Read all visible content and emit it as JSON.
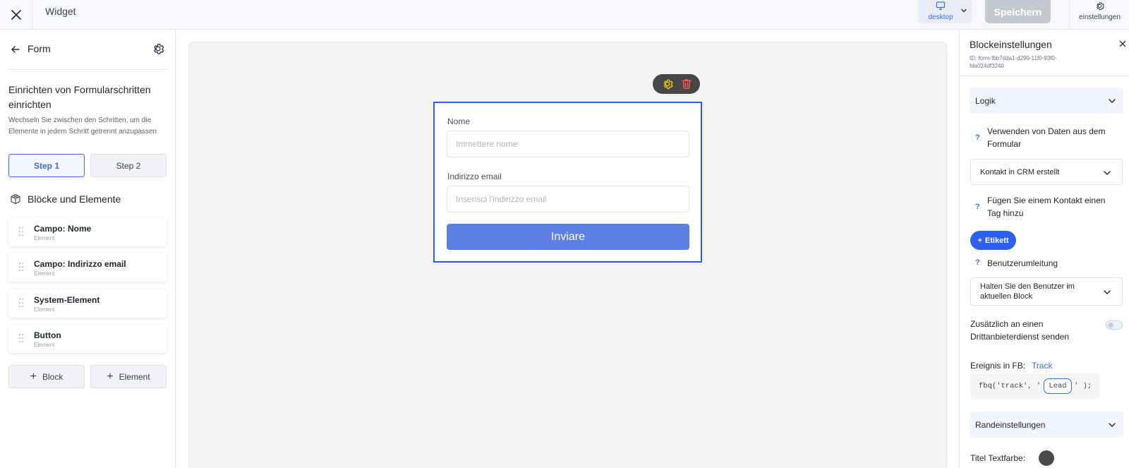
{
  "topbar": {
    "title": "Widget",
    "device_label": "desktop",
    "save_label": "Speichern",
    "settings_label": "einstellungen"
  },
  "left": {
    "header_title": "Form",
    "steps_title": "Einrichten von Formularschritten einrichten",
    "steps_description": "Wechseln Sie zwischen den Schritten, um die Elemente in jedem Schritt getrennt anzupassen",
    "steps": [
      "Step 1",
      "Step 2"
    ],
    "active_step": "Step 1",
    "blocks_title": "Blöcke und Elemente",
    "elements": [
      {
        "name": "Campo: Nome",
        "type": "Element"
      },
      {
        "name": "Campo: Indirizzo email",
        "type": "Element"
      },
      {
        "name": "System-Element",
        "type": "Element"
      },
      {
        "name": "Button",
        "type": "Element"
      }
    ],
    "add_block_label": "Block",
    "add_element_label": "Element"
  },
  "canvas": {
    "form": {
      "name_label": "Nome",
      "name_placeholder": "Immettere nome",
      "email_label": "Indirizzo email",
      "email_placeholder": "Inserisci l'indirizzo email",
      "submit_label": "Inviare"
    }
  },
  "right": {
    "title": "Blockeinstellungen",
    "block_id": "ID: form-fbb7dda1-d290-11f0-93f0-fda024df3240",
    "logic_label": "Logik",
    "use_data_label": "Verwenden von Daten aus dem Formular",
    "use_data_value": "Kontakt in CRM erstellt",
    "add_tag_label": "Fügen Sie einem Kontakt einen Tag hinzu",
    "tag_button_label": "Etikett",
    "redirect_label": "Benutzerumleitung",
    "redirect_value": "Halten Sie den Benutzer im aktuellen Block",
    "third_party_label": "Zusätzlich an einen Drittanbieterdienst senden",
    "third_party_enabled": false,
    "fb_event_label": "Ereignis in FB:",
    "fb_event_link": "Track",
    "code_prefix": "fbq('track', '",
    "code_event": "Lead",
    "code_suffix": "' );",
    "border_settings_label": "Randeinstellungen",
    "title_color_label": "Titel Textfarbe:",
    "title_color_value": "#4a4a4a"
  },
  "colors": {
    "accent": "#3d6cf0",
    "form_border": "#2d5de8",
    "submit": "#5b7fe3",
    "save_disabled": "#c5c8cf",
    "tag_button": "#2d62ee",
    "toolbar_pill": "#474747",
    "delete_icon": "#ff5a4e",
    "settings_icon": "#f0c419"
  }
}
